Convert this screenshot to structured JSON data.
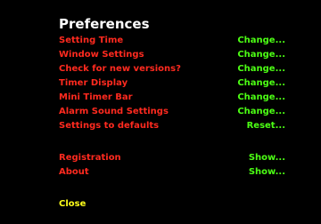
{
  "title": "Preferences",
  "colors": {
    "background": "#000000",
    "title": "#ffffff",
    "label": "#ff2a1f",
    "action": "#4cff14",
    "close": "#ffff1a"
  },
  "settings": [
    {
      "label": "Setting Time",
      "action": "Change..."
    },
    {
      "label": "Window Settings",
      "action": "Change..."
    },
    {
      "label": "Check for new versions?",
      "action": "Change..."
    },
    {
      "label": "Timer Display",
      "action": "Change..."
    },
    {
      "label": "Mini Timer Bar",
      "action": "Change..."
    },
    {
      "label": "Alarm Sound Settings",
      "action": "Change..."
    },
    {
      "label": "Settings to defaults",
      "action": "Reset..."
    }
  ],
  "info": [
    {
      "label": "Registration",
      "action": "Show..."
    },
    {
      "label": "About",
      "action": "Show..."
    }
  ],
  "close_label": "Close"
}
